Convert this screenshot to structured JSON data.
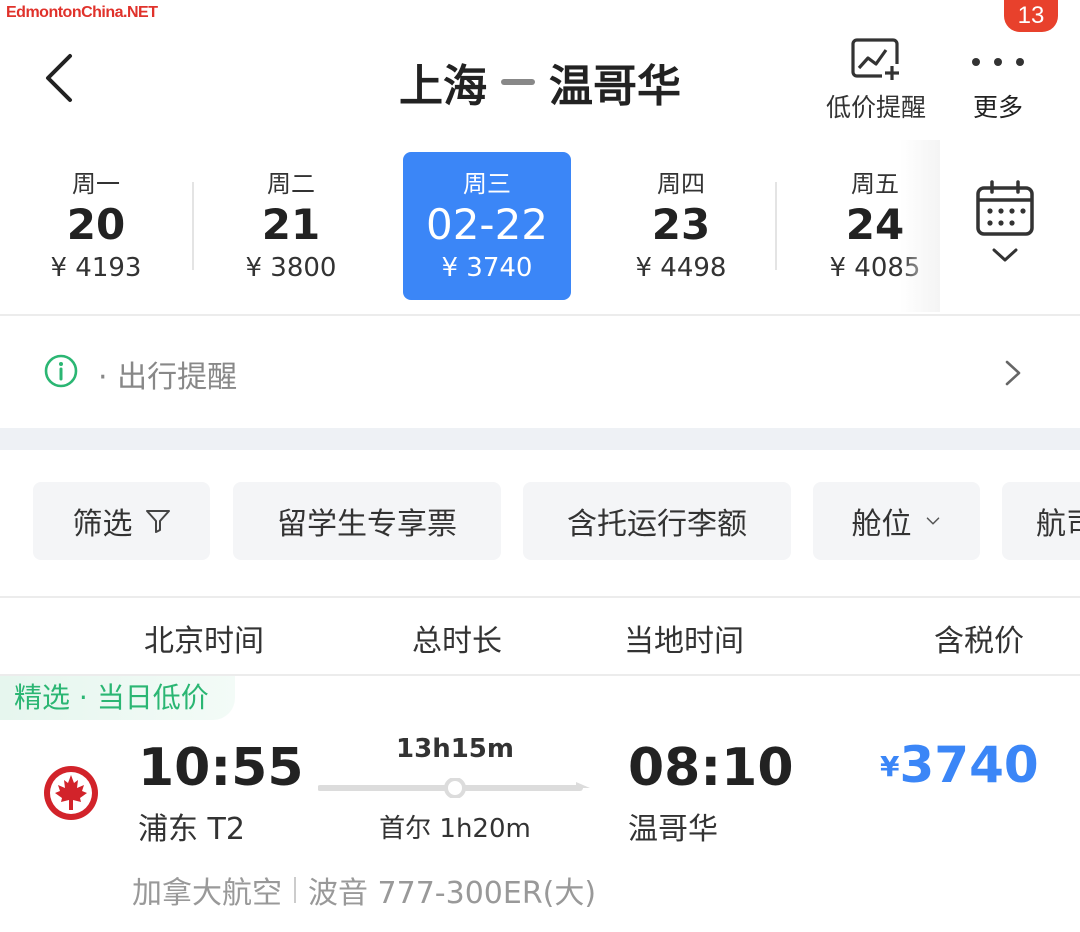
{
  "watermark": "EdmontonChina.NET",
  "header": {
    "origin": "上海",
    "destination": "温哥华",
    "price_alert_label": "低价提醒",
    "more_label": "更多",
    "badge_count": "13"
  },
  "dates": [
    {
      "weekday": "周一",
      "day": "20",
      "price": "¥ 4193",
      "selected": false
    },
    {
      "weekday": "周二",
      "day": "21",
      "price": "¥ 3800",
      "selected": false
    },
    {
      "weekday": "周三",
      "day": "02-22",
      "price": "¥ 3740",
      "selected": true
    },
    {
      "weekday": "周四",
      "day": "23",
      "price": "¥ 4498",
      "selected": false
    },
    {
      "weekday": "周五",
      "day": "24",
      "price": "¥ 4085",
      "selected": false
    }
  ],
  "reminder": {
    "text": "· 出行提醒"
  },
  "filters": [
    {
      "label": "筛选",
      "icon": "filter-icon"
    },
    {
      "label": "留学生专享票"
    },
    {
      "label": "含托运行李额"
    },
    {
      "label": "舱位",
      "icon": "chevron-down-icon"
    },
    {
      "label": "航司"
    }
  ],
  "columns": {
    "departure": "北京时间",
    "duration": "总时长",
    "arrival": "当地时间",
    "price": "含税价"
  },
  "flight": {
    "tag": "精选 · 当日低价",
    "dep_time": "10:55",
    "dep_airport": "浦东 T2",
    "duration": "13h15m",
    "stopover": "首尔 1h20m",
    "arr_time": "08:10",
    "arr_airport": "温哥华",
    "currency": "¥",
    "price": "3740",
    "airline": "加拿大航空",
    "aircraft": "波音 777-300ER(大)"
  },
  "colors": {
    "accent": "#3b86f7",
    "badge": "#e8412c",
    "tag_green": "#2bb673",
    "airline_red": "#d2232a"
  }
}
